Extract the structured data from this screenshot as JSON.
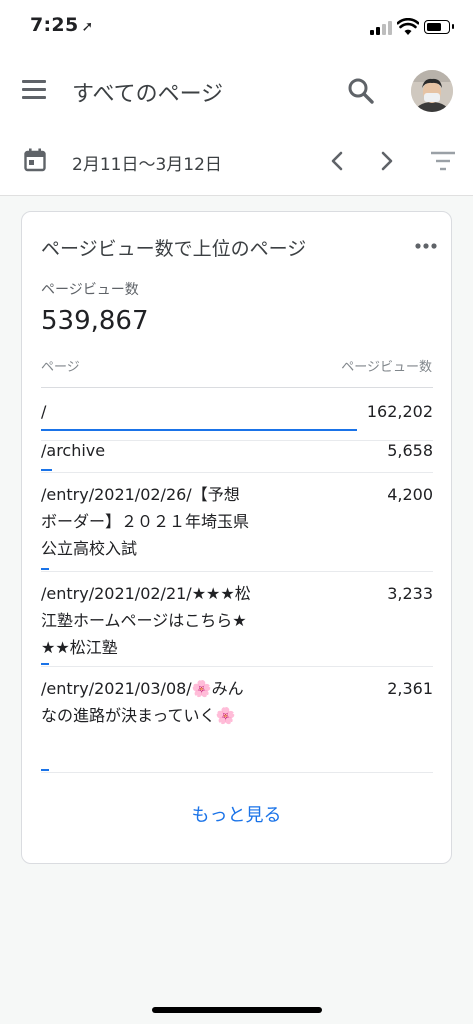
{
  "status": {
    "time": "7:25",
    "arrow": "➚"
  },
  "header": {
    "title": "すべてのページ"
  },
  "filter": {
    "date_range": "2月11日〜3月12日"
  },
  "card": {
    "title": "ページビュー数で上位のページ",
    "metric_label": "ページビュー数",
    "metric_value": "539,867",
    "col_page": "ページ",
    "col_views": "ページビュー数",
    "rows": [
      {
        "path": "/",
        "views": "162,202",
        "ratio": 1.0
      },
      {
        "path": "/archive",
        "views": "5,658",
        "ratio": 0.035
      },
      {
        "path": "/entry/2021/02/26/【予想ボーダー】２０２１年埼玉県公立高校入試",
        "views": "4,200",
        "ratio": 0.026
      },
      {
        "path": "/entry/2021/02/21/★★★松江塾ホームページはこちら★★★松江塾",
        "views": "3,233",
        "ratio": 0.02
      },
      {
        "path": "/entry/2021/03/08/🌸みんなの進路が決まっていく🌸",
        "views": "2,361",
        "ratio": 0.015
      }
    ],
    "see_more": "もっと見る"
  },
  "icons": {
    "menu": "menu-icon",
    "search": "search-icon",
    "calendar": "calendar-icon",
    "prev": "chevron-left-icon",
    "next": "chevron-right-icon",
    "filter": "filter-icon",
    "more": "more-horizontal-icon"
  },
  "colors": {
    "accent": "#1a73e8",
    "background": "#f6f8f7"
  }
}
